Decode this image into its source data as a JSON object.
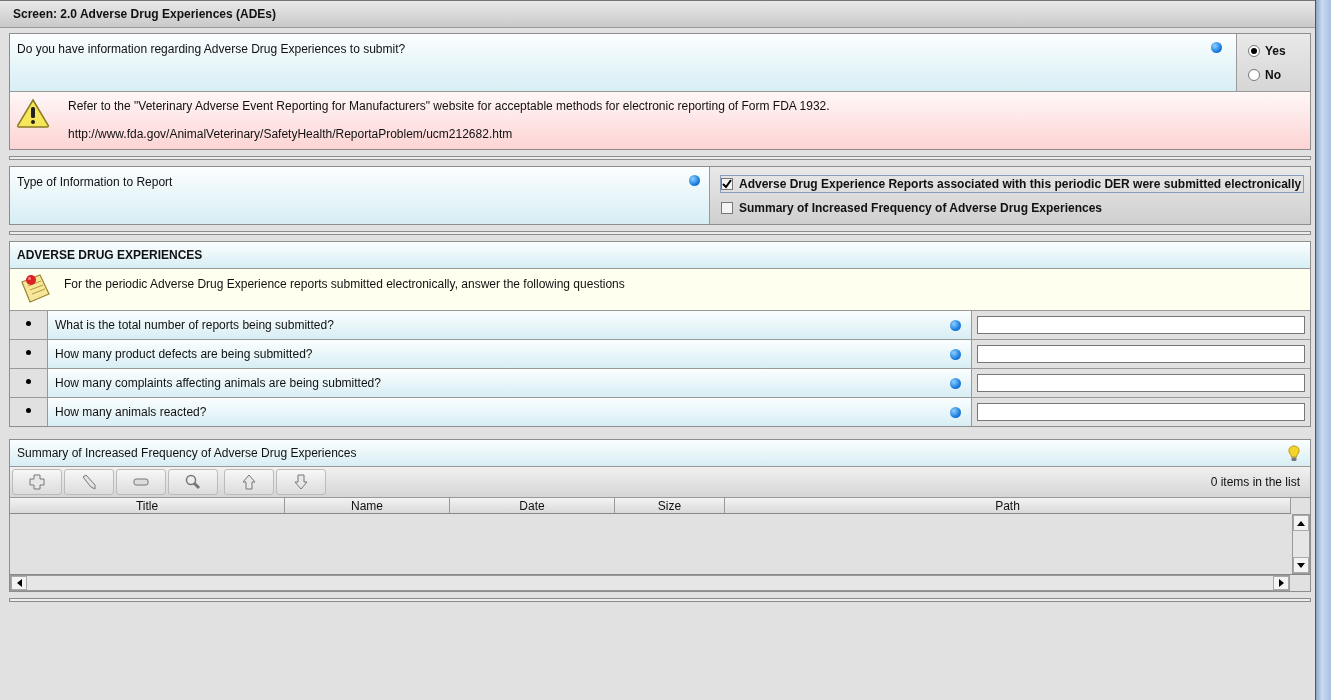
{
  "header": {
    "title": "Screen: 2.0 Adverse Drug Experiences (ADEs)"
  },
  "adverse_question": {
    "label": "Do you have information regarding Adverse Drug Experiences to submit?",
    "options": [
      {
        "label": "Yes",
        "selected": true
      },
      {
        "label": "No",
        "selected": false
      }
    ]
  },
  "warning": {
    "text": "Refer to the \"Veterinary Adverse Event Reporting for Manufacturers\" website for acceptable methods for electronic reporting of Form FDA 1932.",
    "url": "http://www.fda.gov/AnimalVeterinary/SafetyHealth/ReportaProblem/ucm212682.htm"
  },
  "info_type": {
    "label": "Type of Information to Report",
    "options": [
      {
        "label": "Adverse Drug Experience Reports associated with this periodic DER were submitted electronically",
        "checked": true
      },
      {
        "label": "Summary of Increased Frequency of Adverse Drug Experiences",
        "checked": false
      }
    ]
  },
  "ade_section": {
    "title": "ADVERSE DRUG EXPERIENCES",
    "note": "For the periodic Adverse Drug Experience reports submitted electronically, answer the following questions",
    "questions": [
      {
        "label": "What is the total number of reports being submitted?"
      },
      {
        "label": "How many product defects are being submitted?"
      },
      {
        "label": "How many complaints affecting animals are being submitted?"
      },
      {
        "label": "How many animals reacted?"
      }
    ]
  },
  "summary": {
    "title": "Summary of Increased Frequency of Adverse Drug Experiences",
    "count": "0 items in the list",
    "columns": [
      "Title",
      "Name",
      "Date",
      "Size",
      "Path"
    ]
  }
}
